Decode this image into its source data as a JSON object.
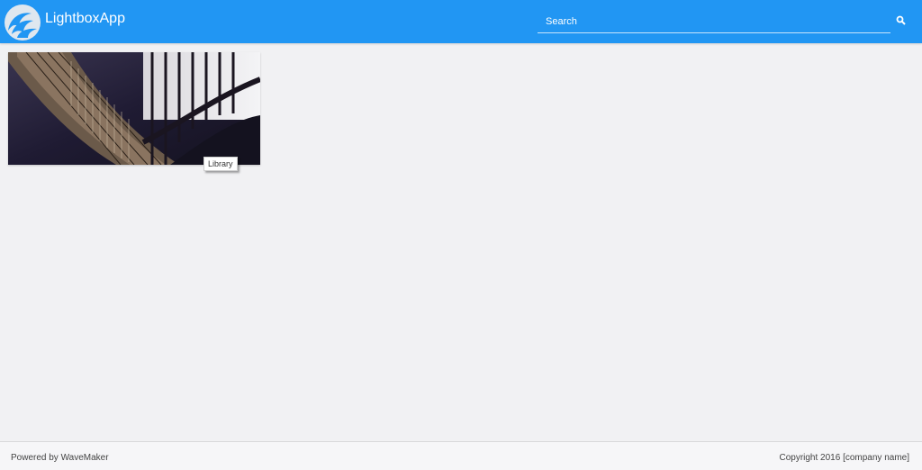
{
  "app": {
    "title": "LightboxApp",
    "logo_icon": "wave-logo-icon"
  },
  "header": {
    "background": "#2196f3",
    "search": {
      "placeholder": "Search",
      "value": "",
      "button_icon": "search-icon"
    }
  },
  "gallery": {
    "items": [
      {
        "caption": "Library",
        "image": "library-bookshelves-photo"
      }
    ]
  },
  "footer": {
    "left_text": "Powered by WaveMaker",
    "right_text": "Copyright 2016 [company name]"
  }
}
